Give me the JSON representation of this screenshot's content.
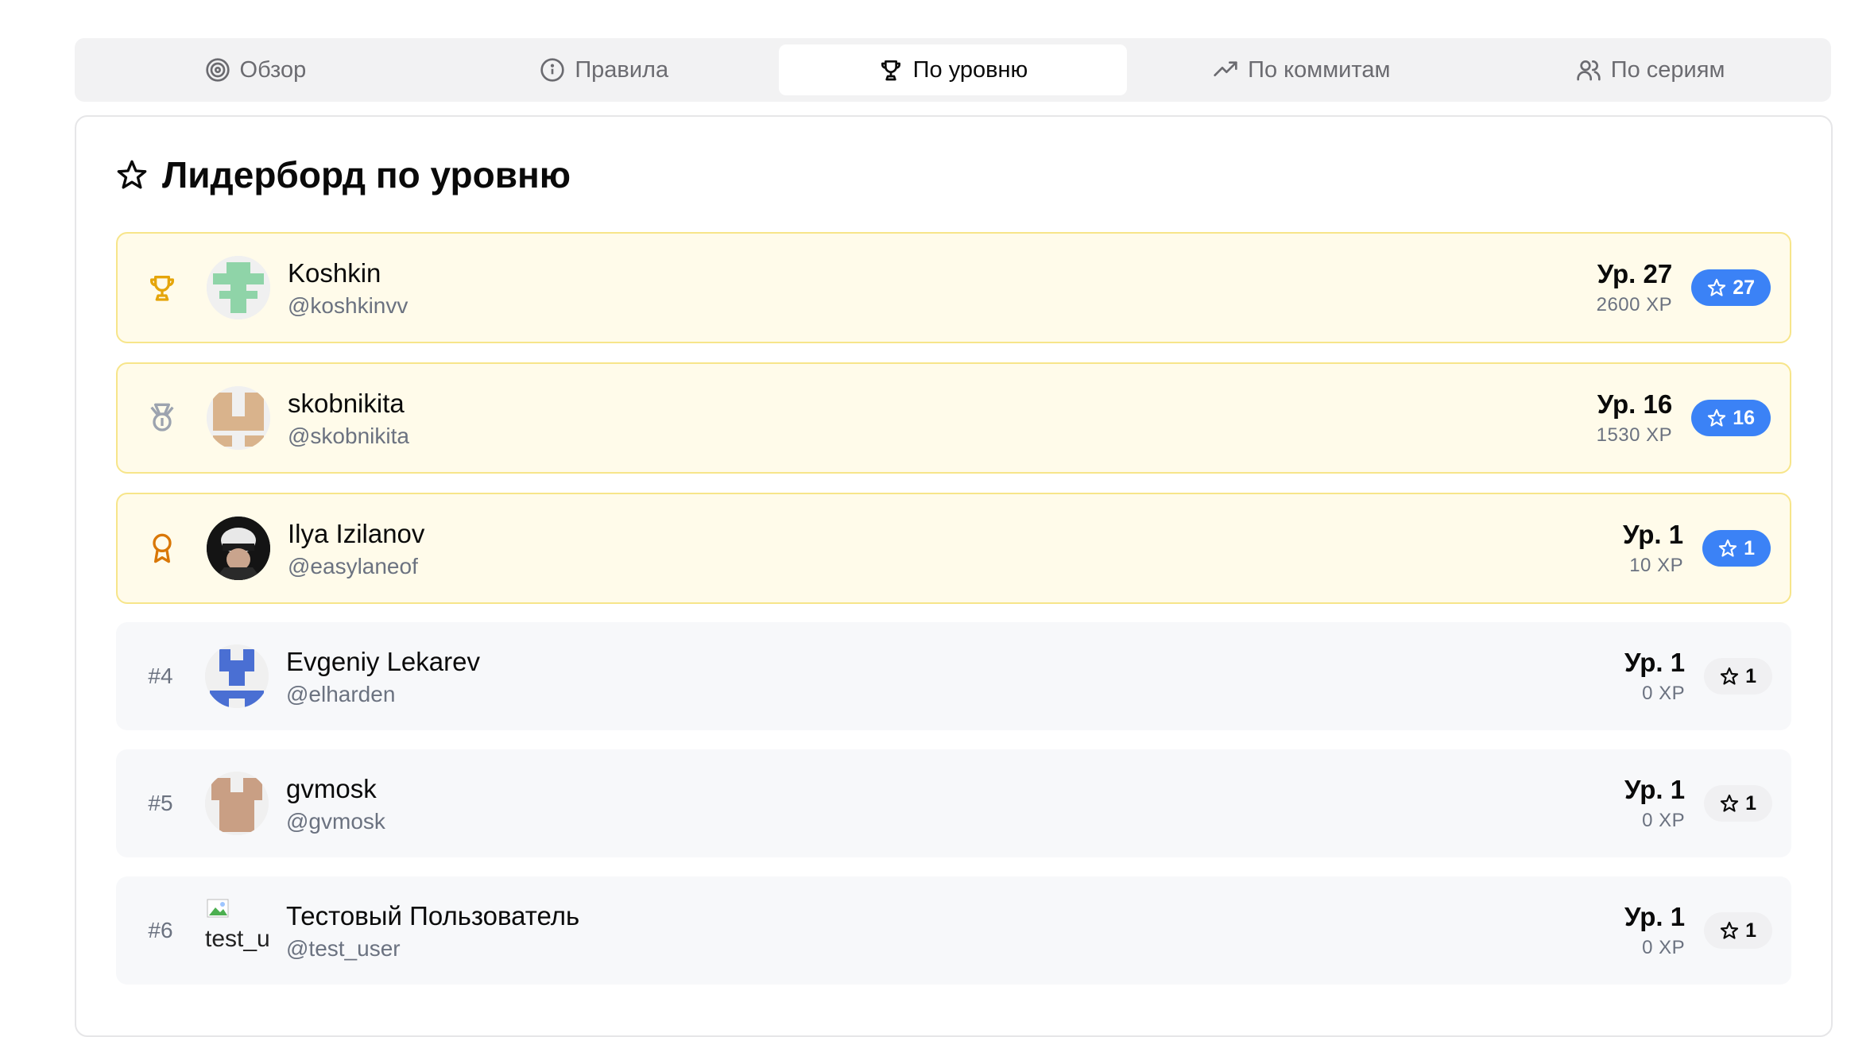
{
  "tabs": [
    {
      "label": "Обзор",
      "icon": "target-icon",
      "active": false
    },
    {
      "label": "Правила",
      "icon": "info-icon",
      "active": false
    },
    {
      "label": "По уровню",
      "icon": "trophy-icon",
      "active": true
    },
    {
      "label": "По коммитам",
      "icon": "trending-up-icon",
      "active": false
    },
    {
      "label": "По сериям",
      "icon": "users-icon",
      "active": false
    }
  ],
  "card": {
    "title": "Лидерборд по уровню",
    "icon": "star-icon"
  },
  "rows": [
    {
      "rank": "1",
      "rank_icon": "trophy-icon",
      "name": "Koshkin",
      "handle": "@koshkinvv",
      "level": "Ур. 27",
      "xp": "2600 XP",
      "badge": "27",
      "highlight": true
    },
    {
      "rank": "2",
      "rank_icon": "medal-icon",
      "name": "skobnikita",
      "handle": "@skobnikita",
      "level": "Ур. 16",
      "xp": "1530 XP",
      "badge": "16",
      "highlight": true
    },
    {
      "rank": "3",
      "rank_icon": "award-icon",
      "name": "Ilya Izilanov",
      "handle": "@easylaneof",
      "level": "Ур. 1",
      "xp": "10 XP",
      "badge": "1",
      "highlight": true
    },
    {
      "rank": "#4",
      "name": "Evgeniy Lekarev",
      "handle": "@elharden",
      "level": "Ур. 1",
      "xp": "0 XP",
      "badge": "1",
      "highlight": false
    },
    {
      "rank": "#5",
      "name": "gvmosk",
      "handle": "@gvmosk",
      "level": "Ур. 1",
      "xp": "0 XP",
      "badge": "1",
      "highlight": false
    },
    {
      "rank": "#6",
      "name": "Тестовый Пользователь",
      "handle": "@test_user",
      "avatar_alt": "test_user",
      "level": "Ур. 1",
      "xp": "0 XP",
      "badge": "1",
      "highlight": false
    }
  ],
  "colors": {
    "accent_blue": "#3b82f6",
    "highlight_bg": "#fffbea",
    "highlight_border": "#f7e58a",
    "gold": "#e5a50a",
    "silver": "#9ca3af",
    "bronze": "#d97706"
  }
}
